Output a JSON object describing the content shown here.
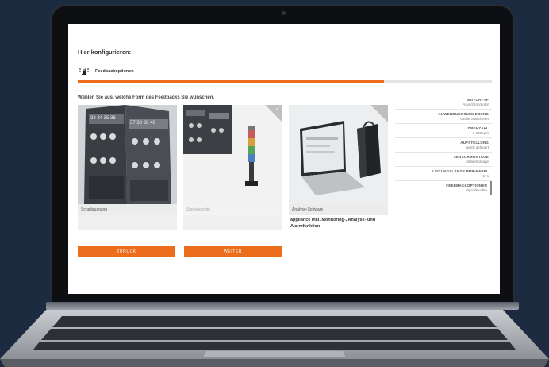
{
  "page": {
    "title": "Hier konfigurieren:",
    "step_label": "Feedbackoptionen",
    "progress": 0.74,
    "question": "Wählen Sie aus, welche Form des Feedbacks Sie wünschen."
  },
  "options": [
    {
      "label": "Schaltausgang",
      "selected": false,
      "description": ""
    },
    {
      "label": "Signalleuchte",
      "selected": true,
      "description": ""
    },
    {
      "label": "Analyse-Software",
      "selected": false,
      "description": "appliance inkl. Monitoring-, Analyse- und Alarmfunktion"
    }
  ],
  "relay_numbers": {
    "left": "33 34 35 36",
    "right": "37 38 39 40"
  },
  "buttons": {
    "back": "ZURÜCK",
    "next": "WEITER"
  },
  "summary": [
    {
      "key": "MOTORTYP",
      "value": "Asynchronmotor"
    },
    {
      "key": "ANWENDUNGSUMGEBUNG",
      "value": "Große Maschinen"
    },
    {
      "key": "DREHZAHL",
      "value": "> 600 rpm"
    },
    {
      "key": "AUFSTELLUNG",
      "value": "weich gelagert"
    },
    {
      "key": "SENSORMONTAGE",
      "value": "Klebemontage"
    },
    {
      "key": "LEITUNGSLÄNGE PUR-KABEL",
      "value": "5 m"
    },
    {
      "key": "FEEDBACKOPTIONEN",
      "value": "Signalleuchte"
    }
  ],
  "colors": {
    "accent": "#ec6e1d",
    "background": "#1c2b40"
  }
}
